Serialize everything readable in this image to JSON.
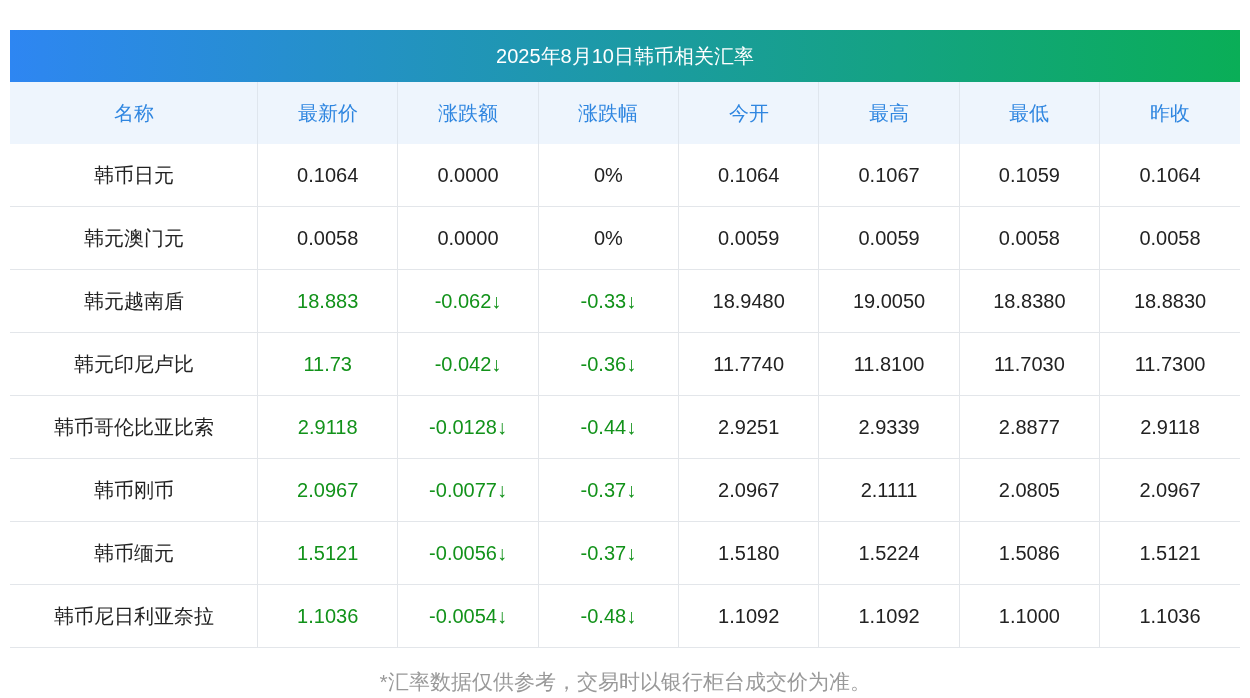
{
  "title": "2025年8月10日韩币相关汇率",
  "columns": [
    "名称",
    "最新价",
    "涨跌额",
    "涨跌幅",
    "今开",
    "最高",
    "最低",
    "昨收"
  ],
  "rows": [
    {
      "falling": false,
      "cells": [
        "韩币日元",
        "0.1064",
        "0.0000",
        "0%",
        "0.1064",
        "0.1067",
        "0.1059",
        "0.1064"
      ]
    },
    {
      "falling": false,
      "cells": [
        "韩元澳门元",
        "0.0058",
        "0.0000",
        "0%",
        "0.0059",
        "0.0059",
        "0.0058",
        "0.0058"
      ]
    },
    {
      "falling": true,
      "cells": [
        "韩元越南盾",
        "18.883",
        "-0.062↓",
        "-0.33↓",
        "18.9480",
        "19.0050",
        "18.8380",
        "18.8830"
      ]
    },
    {
      "falling": true,
      "cells": [
        "韩元印尼卢比",
        "11.73",
        "-0.042↓",
        "-0.36↓",
        "11.7740",
        "11.8100",
        "11.7030",
        "11.7300"
      ]
    },
    {
      "falling": true,
      "cells": [
        "韩币哥伦比亚比索",
        "2.9118",
        "-0.0128↓",
        "-0.44↓",
        "2.9251",
        "2.9339",
        "2.8877",
        "2.9118"
      ]
    },
    {
      "falling": true,
      "cells": [
        "韩币刚币",
        "2.0967",
        "-0.0077↓",
        "-0.37↓",
        "2.0967",
        "2.1111",
        "2.0805",
        "2.0967"
      ]
    },
    {
      "falling": true,
      "cells": [
        "韩币缅元",
        "1.5121",
        "-0.0056↓",
        "-0.37↓",
        "1.5180",
        "1.5224",
        "1.5086",
        "1.5121"
      ]
    },
    {
      "falling": true,
      "cells": [
        "韩币尼日利亚奈拉",
        "1.1036",
        "-0.0054↓",
        "-0.48↓",
        "1.1092",
        "1.1092",
        "1.1000",
        "1.1036"
      ]
    }
  ],
  "footnote": "*汇率数据仅供参考，交易时以银行柜台成交价为准。"
}
